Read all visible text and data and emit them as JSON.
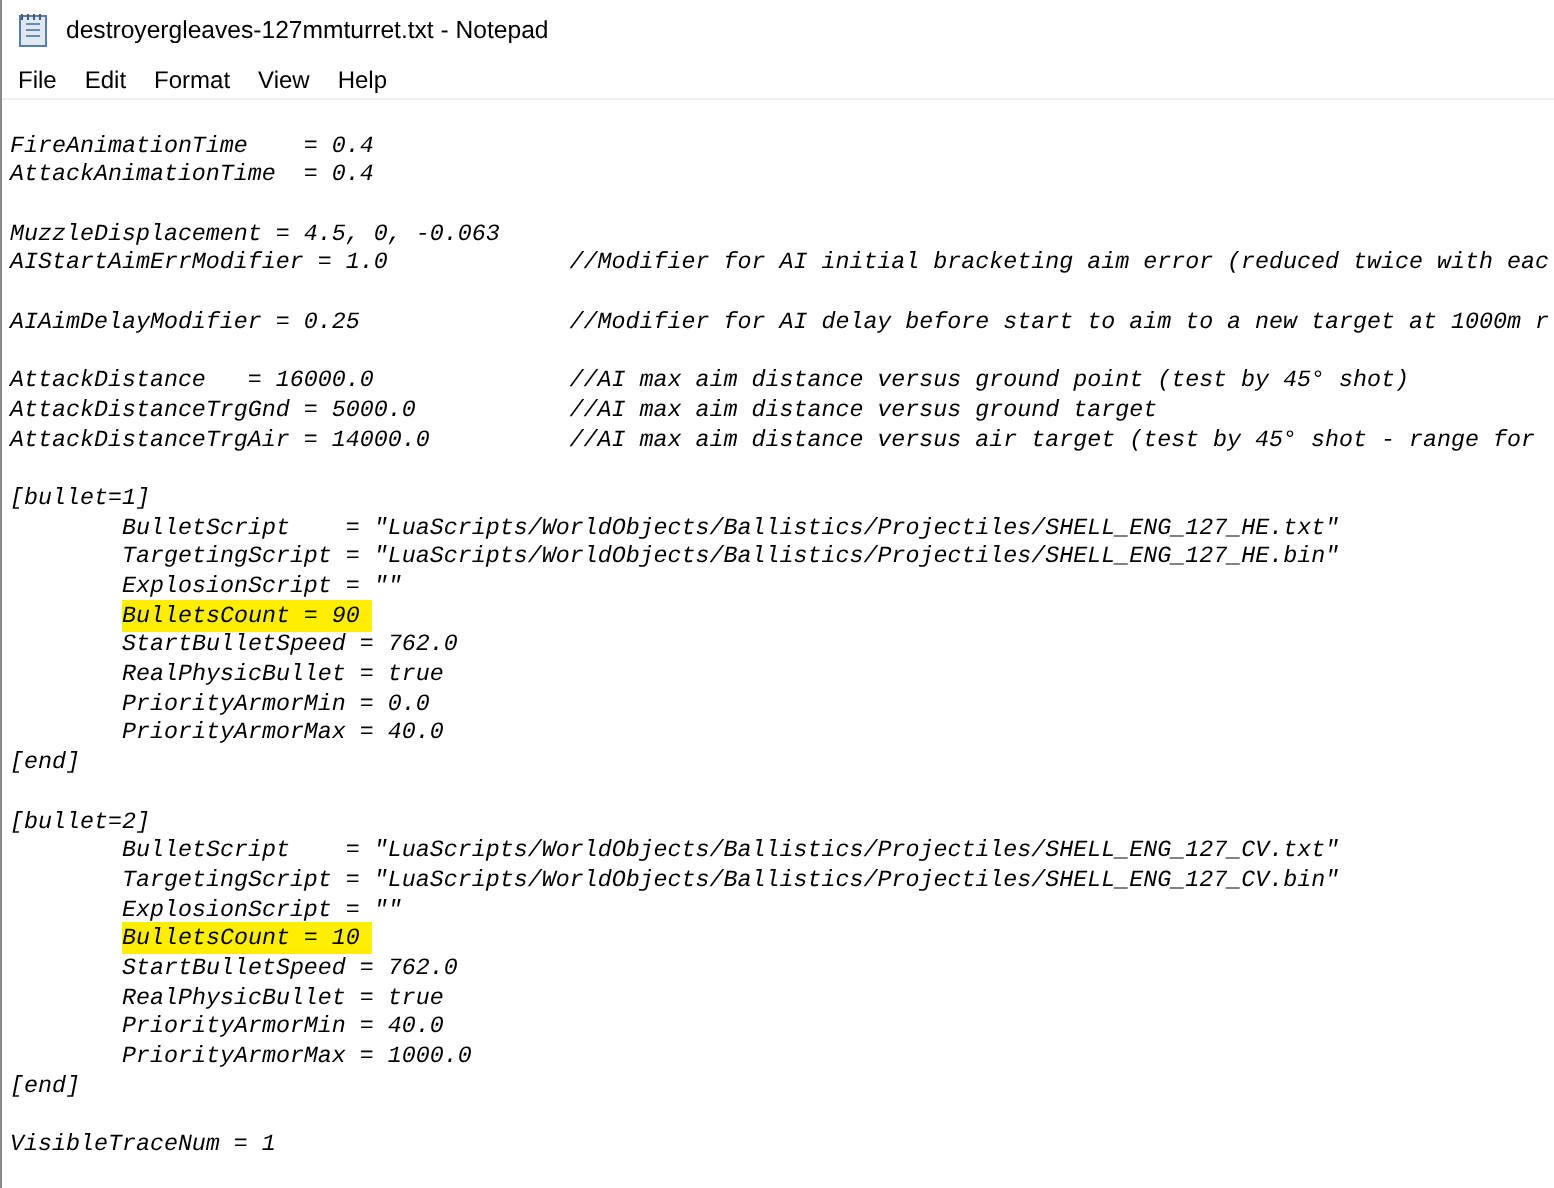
{
  "window": {
    "title": "destroyergleaves-127mmturret.txt - Notepad"
  },
  "menu": [
    "File",
    "Edit",
    "Format",
    "View",
    "Help"
  ],
  "lines": [
    {
      "kind": "blank"
    },
    {
      "kind": "text",
      "text": "FireAnimationTime    = 0.4",
      "highlighted": false
    },
    {
      "kind": "text",
      "text": "AttackAnimationTime  = 0.4",
      "highlighted": false
    },
    {
      "kind": "blank"
    },
    {
      "kind": "text",
      "text": "MuzzleDisplacement = 4.5, 0, -0.063",
      "highlighted": false
    },
    {
      "kind": "text",
      "text": "AIStartAimErrModifier = 1.0             //Modifier for AI initial bracketing aim error (reduced twice with eac",
      "highlighted": false
    },
    {
      "kind": "blank"
    },
    {
      "kind": "text",
      "text": "AIAimDelayModifier = 0.25               //Modifier for AI delay before start to aim to a new target at 1000m r",
      "highlighted": false
    },
    {
      "kind": "blank"
    },
    {
      "kind": "text",
      "text": "AttackDistance   = 16000.0              //AI max aim distance versus ground point (test by 45° shot)",
      "highlighted": false
    },
    {
      "kind": "text",
      "text": "AttackDistanceTrgGnd = 5000.0           //AI max aim distance versus ground target",
      "highlighted": false
    },
    {
      "kind": "text",
      "text": "AttackDistanceTrgAir = 14000.0          //AI max aim distance versus air target (test by 45° shot - range for",
      "highlighted": false
    },
    {
      "kind": "blank"
    },
    {
      "kind": "text",
      "text": "[bullet=1]",
      "highlighted": false,
      "children": [
        {
          "kind": "text",
          "text": "BulletScript    = \"LuaScripts/WorldObjects/Ballistics/Projectiles/SHELL_ENG_127_HE.txt\"",
          "highlighted": false
        },
        {
          "kind": "text",
          "text": "TargetingScript = \"LuaScripts/WorldObjects/Ballistics/Projectiles/SHELL_ENG_127_HE.bin\"",
          "highlighted": false
        },
        {
          "kind": "text",
          "text": "ExplosionScript = \"\"",
          "highlighted": false
        },
        {
          "kind": "text",
          "text": "BulletsCount = 90",
          "highlighted": true
        },
        {
          "kind": "text",
          "text": "StartBulletSpeed = 762.0",
          "highlighted": false
        },
        {
          "kind": "text",
          "text": "RealPhysicBullet = true",
          "highlighted": false
        },
        {
          "kind": "text",
          "text": "PriorityArmorMin = 0.0",
          "highlighted": false
        },
        {
          "kind": "text",
          "text": "PriorityArmorMax = 40.0",
          "highlighted": false
        }
      ]
    },
    {
      "kind": "text",
      "text": "[end]",
      "highlighted": false
    },
    {
      "kind": "blank"
    },
    {
      "kind": "text",
      "text": "[bullet=2]",
      "highlighted": false,
      "children": [
        {
          "kind": "text",
          "text": "BulletScript    = \"LuaScripts/WorldObjects/Ballistics/Projectiles/SHELL_ENG_127_CV.txt\"",
          "highlighted": false
        },
        {
          "kind": "text",
          "text": "TargetingScript = \"LuaScripts/WorldObjects/Ballistics/Projectiles/SHELL_ENG_127_CV.bin\"",
          "highlighted": false
        },
        {
          "kind": "text",
          "text": "ExplosionScript = \"\"",
          "highlighted": false
        },
        {
          "kind": "text",
          "text": "BulletsCount = 10",
          "highlighted": true
        },
        {
          "kind": "text",
          "text": "StartBulletSpeed = 762.0",
          "highlighted": false
        },
        {
          "kind": "text",
          "text": "RealPhysicBullet = true",
          "highlighted": false
        },
        {
          "kind": "text",
          "text": "PriorityArmorMin = 40.0",
          "highlighted": false
        },
        {
          "kind": "text",
          "text": "PriorityArmorMax = 1000.0",
          "highlighted": false
        }
      ]
    },
    {
      "kind": "text",
      "text": "[end]",
      "highlighted": false
    },
    {
      "kind": "blank"
    },
    {
      "kind": "text",
      "text": "VisibleTraceNum = 1",
      "highlighted": false
    }
  ]
}
